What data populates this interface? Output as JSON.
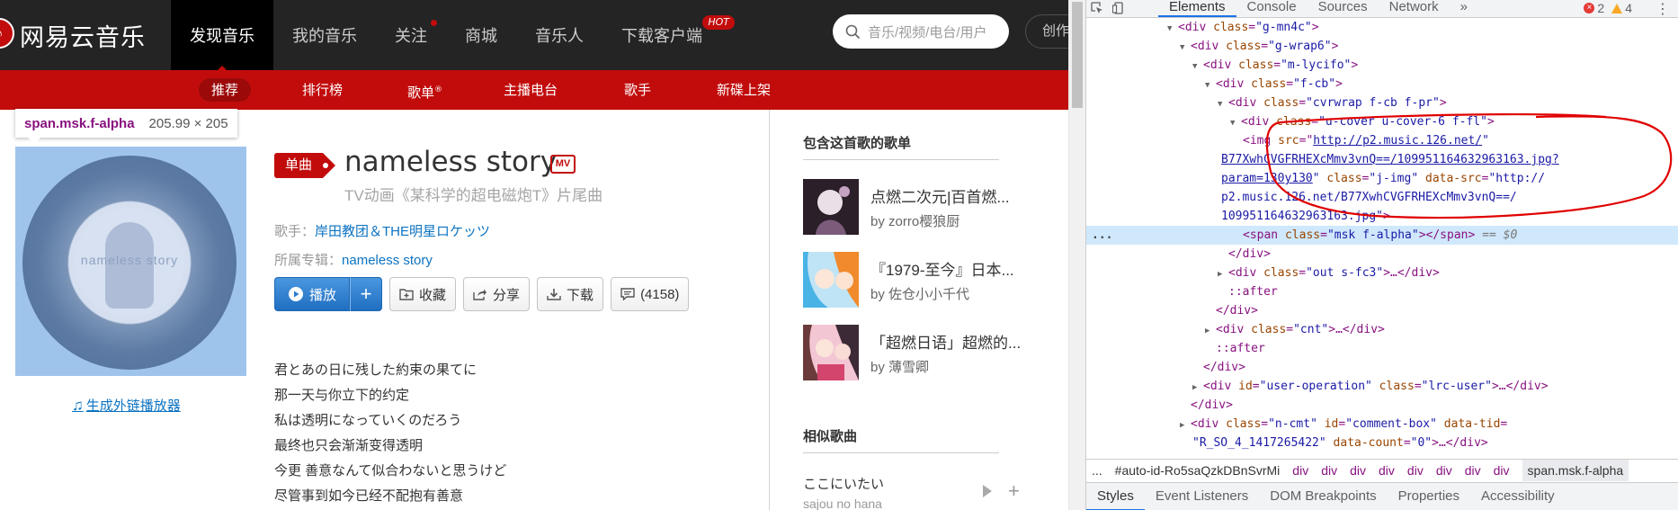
{
  "site": {
    "logo_text": "网易云音乐",
    "nav": [
      "发现音乐",
      "我的音乐",
      "关注",
      "商城",
      "音乐人",
      "下载客户端"
    ],
    "hot_badge": "HOT",
    "search_placeholder": "音乐/视频/电台/用户",
    "creator_button": "创作",
    "subnav": [
      "推荐",
      "排行榜",
      "歌单",
      "主播电台",
      "歌手",
      "新碟上架"
    ],
    "subnav_registered_mark": "®",
    "accent_color": "#c20c0c"
  },
  "inspect_tooltip": {
    "selector": "span.msk.f-alpha",
    "size": "205.99 × 205"
  },
  "song": {
    "cover_text": "nameless story",
    "badge": "单曲",
    "title": "nameless story",
    "mv_label": "MV",
    "subtitle": "TV动画《某科学的超电磁炮T》片尾曲",
    "artist_label": "歌手：",
    "artist": "岸田教团＆THE明星ロケッツ",
    "album_label": "所属专辑：",
    "album": "nameless story",
    "outchain_link": "生成外链播放器",
    "actions": {
      "play": "播放",
      "collect": "收藏",
      "share": "分享",
      "download": "下载",
      "comment": "(4158)"
    },
    "lyrics": [
      "君とあの日に残した約束の果てに",
      "那一天与你立下的约定",
      "私は透明になっていくのだろう",
      "最终也只会渐渐变得透明",
      "今更 善意なんて似合わないと思うけど",
      "尽管事到如今已经不配抱有善意"
    ]
  },
  "sidebar": {
    "playlists_heading": "包含这首歌的歌单",
    "playlists": [
      {
        "name": "点燃二次元|百首燃...",
        "by_label": "by",
        "author": "zorro樱狼厨"
      },
      {
        "name": "『1979-至今』日本...",
        "by_label": "by",
        "author": "佐仓小小千代"
      },
      {
        "name": "「超燃日语」超燃的...",
        "by_label": "by",
        "author": "薄雪卿"
      }
    ],
    "similar_heading": "相似歌曲",
    "similar": {
      "name": "ここにいたい",
      "artist": "sajou no hana"
    }
  },
  "devtools": {
    "tabs": [
      "Elements",
      "Console",
      "Sources",
      "Network"
    ],
    "more_tabs": "»",
    "errors": "2",
    "warnings": "4",
    "dom": [
      {
        "indent": 8,
        "tri": "▼",
        "open": "<div ",
        "attr": "class",
        "val": "\"g-mn4c\"",
        "close": ">"
      },
      {
        "indent": 9,
        "tri": "▼",
        "open": "<div ",
        "attr": "class",
        "val": "\"g-wrap6\"",
        "close": ">"
      },
      {
        "indent": 10,
        "tri": "▼",
        "open": "<div ",
        "attr": "class",
        "val": "\"m-lycifo\"",
        "close": ">"
      },
      {
        "indent": 11,
        "tri": "▼",
        "open": "<div ",
        "attr": "class",
        "val": "\"f-cb\"",
        "close": ">"
      },
      {
        "indent": 12,
        "tri": "▼",
        "open": "<div ",
        "attr": "class",
        "val": "\"cvrwrap f-cb f-pr\"",
        "close": ">"
      },
      {
        "indent": 13,
        "tri": "▼",
        "open": "<div ",
        "attr": "class",
        "val": "\"u-cover u-cover-6 f-fl\"",
        "close": ">"
      }
    ],
    "img_line": {
      "tag_open": "<img ",
      "src_attr": "src",
      "src_url": "http://p2.music.126.net/B77XwhCVGFRHEXcMmv3vnQ==/109951164632963163.jpg?param=130y130",
      "src_url_l1": "http://p2.music.126.net/",
      "src_url_l2": "B77XwhCVGFRHEXcMmv3vnQ==/109951164632963163.jpg?",
      "src_url_l3": "param=130y130",
      "class_attr": "class",
      "class_val": "\"j-img\"",
      "data_src_attr": "data-src",
      "data_src_l1": "\"http://",
      "data_src_l2": "p2.music.126.net/B77XwhCVGFRHEXcMmv3vnQ==/",
      "data_src_l3": "109951164632963163.jpg\"",
      "close": ">"
    },
    "selected_line": {
      "open": "<span ",
      "attr": "class",
      "val": "\"msk f-alpha\"",
      "close": "></span>",
      "eq": "== $0"
    },
    "tail": [
      {
        "indent": 12,
        "tri": "",
        "text": "</div>"
      },
      {
        "indent": 12,
        "tri": "▶",
        "open": "<div ",
        "attr": "class",
        "val": "\"out s-fc3\"",
        "close": ">…</div>"
      },
      {
        "indent": 12,
        "tri": "",
        "pseudo": "::after"
      },
      {
        "indent": 11,
        "tri": "",
        "text": "</div>"
      },
      {
        "indent": 11,
        "tri": "▶",
        "open": "<div ",
        "attr": "class",
        "val": "\"cnt\"",
        "close": ">…</div>"
      },
      {
        "indent": 11,
        "tri": "",
        "pseudo": "::after"
      },
      {
        "indent": 10,
        "tri": "",
        "text": "</div>"
      },
      {
        "indent": 10,
        "tri": "▶",
        "open": "<div ",
        "attr": "id",
        "val": "\"user-operation\"",
        "attr2": "class",
        "val2": "\"lrc-user\"",
        "close": ">…</div>"
      },
      {
        "indent": 9,
        "tri": "",
        "text": "</div>"
      },
      {
        "indent": 9,
        "tri": "▶",
        "open": "<div ",
        "attr": "class",
        "val": "\"n-cmt\"",
        "attr2": "id",
        "val2": "\"comment-box\"",
        "attr3": "data-tid",
        "val3": "="
      }
    ],
    "last_line": {
      "val": "\"R_SO_4_1417265422\"",
      "attr": "data-count",
      "val2": "\"0\"",
      "close": ">…</div>"
    },
    "breadcrumbs": [
      "#auto-id-Ro5saQzkDBnSvrMi",
      "div",
      "div",
      "div",
      "div",
      "div",
      "div",
      "div",
      "div",
      "span.msk.f-alpha"
    ],
    "bottom_tabs": [
      "Styles",
      "Event Listeners",
      "DOM Breakpoints",
      "Properties",
      "Accessibility"
    ],
    "dom_ellipsis": "..."
  }
}
